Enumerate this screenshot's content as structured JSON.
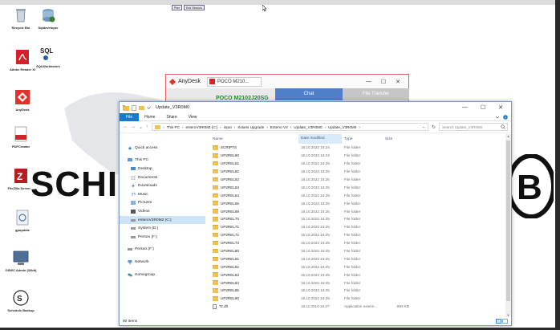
{
  "desktop": {
    "toolbar": [
      "Plan",
      "End Session"
    ],
    "icons": [
      {
        "label": "Recycle Bin",
        "icon": "recycle-bin-icon"
      },
      {
        "label": "Sqldeveloper",
        "icon": "sqldeveloper-icon"
      },
      {
        "label": "Adobe Reader XI",
        "icon": "adobe-reader-icon"
      },
      {
        "label": "SQLWorkbench",
        "icon": "sql-icon"
      },
      {
        "label": "AnyDesk",
        "icon": "anydesk-icon"
      },
      {
        "label": "PDFCreator",
        "icon": "pdf-creator-icon"
      },
      {
        "label": "FileZilla Server ...",
        "icon": "filezilla-icon"
      },
      {
        "label": "gpupdate",
        "icon": "gpupdate-icon"
      },
      {
        "label": "OSWC Admin (32bit)",
        "icon": "admin-icon"
      },
      {
        "label": "Schedule Backup",
        "icon": "schedule-icon"
      }
    ],
    "logo_text": "SCHI",
    "logo_right_text": "B"
  },
  "anydesk": {
    "app_name": "AnyDesk",
    "tab_label": "POCO M210...",
    "device_name": "POCO M2102J20SG",
    "chat_label": "Chat",
    "file_transfer_label": "File Transfer",
    "min_glyph": "—",
    "max_glyph": "☐",
    "close_glyph": "✕"
  },
  "explorer": {
    "title": "Update_V3R0M0",
    "ribbon": [
      "File",
      "Home",
      "Share",
      "View"
    ],
    "path": [
      "This PC",
      "enteroV3R0M2 (C:)",
      "input",
      "Solaris Upgrade",
      "Enterro V3",
      "Update_V3R0M0",
      "Update_V3R0M0"
    ],
    "search_placeholder": "Search Update_V3R0M0",
    "columns": {
      "name": "Name",
      "date": "Date modified",
      "type": "Type",
      "size": "Size"
    },
    "nav": [
      {
        "label": "Quick access",
        "icon": "star-icon"
      },
      {
        "label": "This PC",
        "icon": "computer-icon"
      },
      {
        "label": "Desktop",
        "icon": "desktop-icon"
      },
      {
        "label": "Documents",
        "icon": "documents-icon"
      },
      {
        "label": "Downloads",
        "icon": "downloads-icon"
      },
      {
        "label": "Music",
        "icon": "music-icon"
      },
      {
        "label": "Pictures",
        "icon": "pictures-icon"
      },
      {
        "label": "Videos",
        "icon": "videos-icon"
      },
      {
        "label": "enteroV3R0M2 (C:)",
        "icon": "drive-icon"
      },
      {
        "label": "System (D:)",
        "icon": "drive-icon"
      },
      {
        "label": "Person (F:)",
        "icon": "drive-icon"
      },
      {
        "label": "Person (F:)",
        "icon": "drive-icon"
      },
      {
        "label": "Network",
        "icon": "network-icon"
      },
      {
        "label": "Homegroup",
        "icon": "homegroup-icon"
      }
    ],
    "rows": [
      {
        "name": "SCRIPTS",
        "date": "19.10.2022 16:24",
        "type": "File folder",
        "size": ""
      },
      {
        "name": "UP2REL50",
        "date": "19.10.2022 16:24",
        "type": "File folder",
        "size": ""
      },
      {
        "name": "UP2REL51",
        "date": "19.10.2022 16:25",
        "type": "File folder",
        "size": ""
      },
      {
        "name": "UP2REL52",
        "date": "19.10.2022 16:25",
        "type": "File folder",
        "size": ""
      },
      {
        "name": "UP2REL53",
        "date": "19.10.2022 16:25",
        "type": "File folder",
        "size": ""
      },
      {
        "name": "UP2REL63",
        "date": "19.10.2022 16:25",
        "type": "File folder",
        "size": ""
      },
      {
        "name": "UP2REL64",
        "date": "19.10.2022 16:25",
        "type": "File folder",
        "size": ""
      },
      {
        "name": "UP2REL65",
        "date": "19.10.2022 16:25",
        "type": "File folder",
        "size": ""
      },
      {
        "name": "UP2REL69",
        "date": "19.10.2022 16:25",
        "type": "File folder",
        "size": ""
      },
      {
        "name": "UP2REL70",
        "date": "19.10.2022 16:25",
        "type": "File folder",
        "size": ""
      },
      {
        "name": "UP2REL71",
        "date": "19.10.2022 16:25",
        "type": "File folder",
        "size": ""
      },
      {
        "name": "UP2REL72",
        "date": "19.10.2022 16:25",
        "type": "File folder",
        "size": ""
      },
      {
        "name": "UP2REL73",
        "date": "19.10.2022 16:25",
        "type": "File folder",
        "size": ""
      },
      {
        "name": "UP2REL80",
        "date": "19.10.2022 16:25",
        "type": "File folder",
        "size": ""
      },
      {
        "name": "UP2REL81",
        "date": "19.10.2022 16:25",
        "type": "File folder",
        "size": ""
      },
      {
        "name": "UP2REL82",
        "date": "19.10.2022 16:25",
        "type": "File folder",
        "size": ""
      },
      {
        "name": "UP2REL83",
        "date": "19.10.2022 16:25",
        "type": "File folder",
        "size": ""
      },
      {
        "name": "UP2REL84",
        "date": "19.10.2022 16:25",
        "type": "File folder",
        "size": ""
      },
      {
        "name": "UP2REL85",
        "date": "19.10.2022 16:25",
        "type": "File folder",
        "size": ""
      },
      {
        "name": "UP2REL90",
        "date": "19.10.2022 16:25",
        "type": "File folder",
        "size": ""
      },
      {
        "name": "7z.dll",
        "date": "18.11.2010 16:27",
        "type": "Application extens...",
        "size": "893 KB"
      }
    ],
    "status": "80 items"
  }
}
